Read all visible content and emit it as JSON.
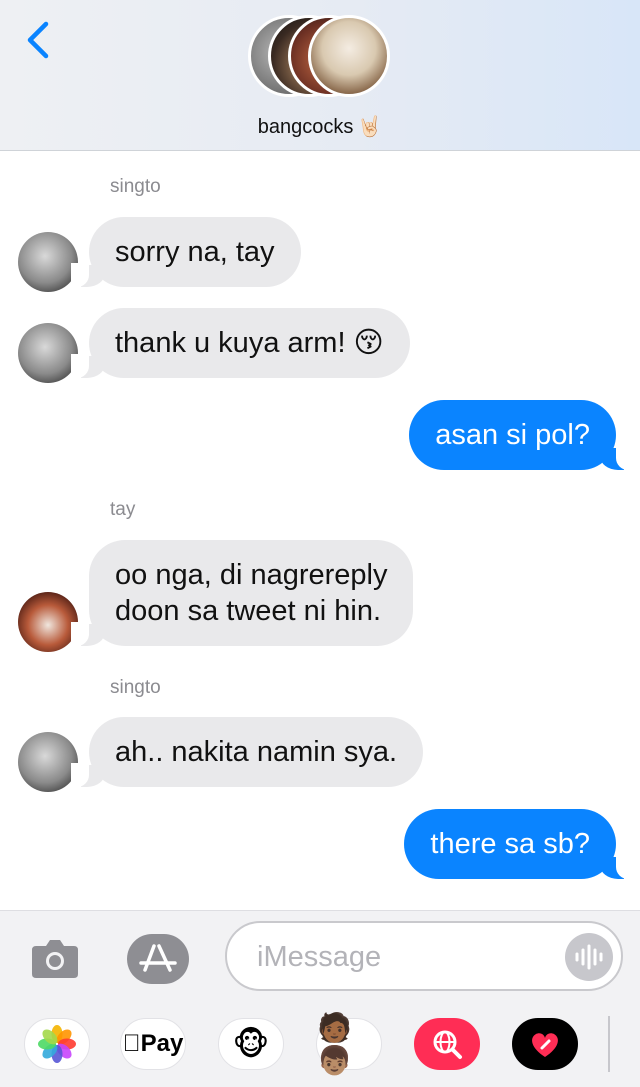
{
  "header": {
    "back_label": "Back",
    "group_name": "bangcocks",
    "group_emoji": "🤘🏻",
    "avatar_count": 4
  },
  "messages": [
    {
      "sender": "singto",
      "direction": "incoming",
      "text": "sorry na, tay"
    },
    {
      "sender": "singto",
      "direction": "incoming",
      "text": "thank u kuya arm! 😚"
    },
    {
      "sender": "me",
      "direction": "outgoing",
      "text": "asan si pol?"
    },
    {
      "sender": "tay",
      "direction": "incoming",
      "text": "oo nga, di nagrereply\ndoon sa tweet ni hin."
    },
    {
      "sender": "singto",
      "direction": "incoming",
      "text": "ah.. nakita namin sya."
    },
    {
      "sender": "me",
      "direction": "outgoing",
      "text": "there sa sb?"
    }
  ],
  "sender_labels": [
    "singto",
    "tay",
    "singto"
  ],
  "input": {
    "placeholder": "iMessage"
  },
  "app_drawer": [
    {
      "name": "photos",
      "label": ""
    },
    {
      "name": "apple-pay",
      "label": "Pay"
    },
    {
      "name": "animoji",
      "label": "🐵"
    },
    {
      "name": "memoji",
      "label": "👨🏾‍🤝‍👨🏽"
    },
    {
      "name": "web-search",
      "label": ""
    },
    {
      "name": "digital-touch",
      "label": ""
    }
  ],
  "colors": {
    "outgoing_bubble": "#0a84ff",
    "incoming_bubble": "#e9e9eb",
    "accent": "#0a84ff"
  }
}
